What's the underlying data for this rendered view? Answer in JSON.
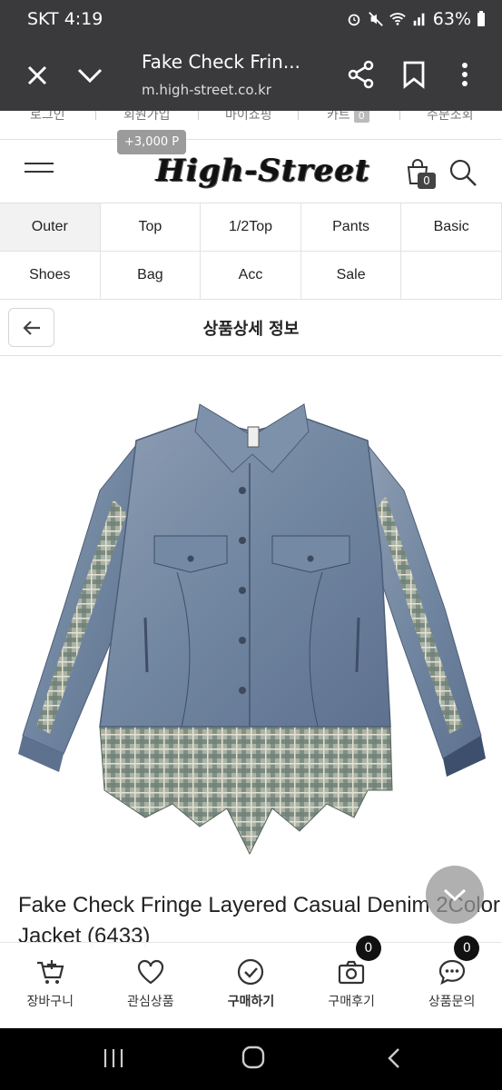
{
  "status_bar": {
    "carrier_time": "SKT 4:19",
    "battery": "63%"
  },
  "browser": {
    "title": "Fake Check Frin...",
    "url": "m.high-street.co.kr"
  },
  "top_links": {
    "items": [
      "로그인",
      "회원가입",
      "마이쇼핑",
      "카트",
      "주문조회"
    ],
    "cart_count": "0",
    "points": "+3,000 P"
  },
  "header": {
    "logo": "High-Street",
    "cart_count": "0"
  },
  "categories": [
    "Outer",
    "Top",
    "1/2Top",
    "Pants",
    "Basic",
    "Shoes",
    "Bag",
    "Acc",
    "Sale",
    ""
  ],
  "section": {
    "title": "상품상세 정보"
  },
  "product": {
    "name": "Fake Check Fringe Layered Casual Denim 2Color Jacket (6433)"
  },
  "actions": [
    {
      "label": "장바구니",
      "icon": "cart-plus-icon"
    },
    {
      "label": "관심상품",
      "icon": "heart-icon"
    },
    {
      "label": "구매하기",
      "icon": "check-circle-icon"
    },
    {
      "label": "구매후기",
      "icon": "camera-icon",
      "badge": "0"
    },
    {
      "label": "상품문의",
      "icon": "chat-icon",
      "badge": "0"
    }
  ]
}
